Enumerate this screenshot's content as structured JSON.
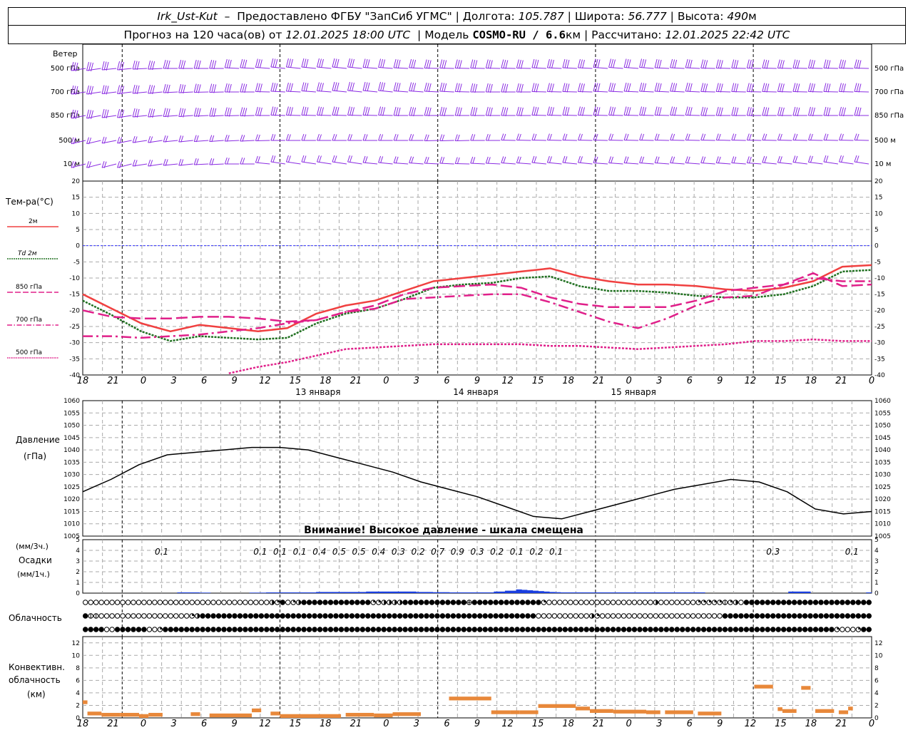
{
  "header": {
    "station": "Irk_Ust-Kut",
    "provider": "Предоставлено ФГБУ \"ЗапСиб УГМС\"",
    "lon_label": "Долгота:",
    "lon_value": "105.787",
    "lat_label": "Широта:",
    "lat_value": "56.777",
    "alt_label": "Высота:",
    "alt_value": "490",
    "alt_unit": "м",
    "forecast_label": "Прогноз на 120 часа(ов) от",
    "forecast_time": "12.01.2025 18:00 UTC",
    "model_label": "Модель",
    "model_name": "COSMO-RU / 6.6",
    "model_unit": "км",
    "calc_label": "Рассчитано:",
    "calc_time": "12.01.2025 22:42 UTC"
  },
  "labels": {
    "wind": "Ветер",
    "wind_levels": [
      "500 гПа",
      "700 гПа",
      "850 гПа",
      "500 м",
      "10 м"
    ],
    "temp": "Тем-ра(°C)",
    "pressure": "Давление",
    "pressure_unit": "(гПа)",
    "precip_unit_3h": "(мм/3ч.)",
    "precip": "Осадки",
    "precip_unit_1h": "(мм/1ч.)",
    "cloud": "Облачность",
    "conv_1": "Конвективн.",
    "conv_2": "облачность",
    "conv_3": "(км)",
    "warning": "Внимание! Высокое давление - шкала смещена",
    "days": [
      "13 января",
      "14 января",
      "15 января"
    ]
  },
  "chart_data": {
    "type": "line",
    "time_ticks": [
      "18",
      "21",
      "0",
      "3",
      "6",
      "9",
      "12",
      "15",
      "18",
      "21",
      "0",
      "3",
      "6",
      "9",
      "12",
      "15",
      "18",
      "21",
      "0",
      "3",
      "6",
      "9",
      "12",
      "15",
      "18",
      "21",
      "0"
    ],
    "temperature": {
      "ylim": [
        -40,
        20
      ],
      "ticks": [
        20,
        15,
        10,
        5,
        0,
        -5,
        -10,
        -15,
        -20,
        -25,
        -30,
        -35,
        -40
      ],
      "series": [
        {
          "name": "2м",
          "color": "#f04040",
          "values": [
            -15,
            -19.5,
            -24,
            -26.5,
            -24.5,
            -25.5,
            -26.5,
            -25.5,
            -21,
            -18.5,
            -17,
            -14,
            -11,
            -10,
            -9,
            -8,
            -7,
            -9.5,
            -11,
            -12,
            -12,
            -12.5,
            -13.5,
            -14,
            -13,
            -11,
            -6.5,
            -6
          ]
        },
        {
          "name": "Td 2м",
          "color": "#207020",
          "values": [
            -17,
            -21.5,
            -26.5,
            -29.5,
            -28,
            -28.5,
            -29,
            -28.5,
            -24,
            -21,
            -19.5,
            -16.5,
            -13,
            -12,
            -11.5,
            -10,
            -9.5,
            -12.5,
            -14,
            -14,
            -14.5,
            -15.5,
            -16,
            -16,
            -15,
            -12.5,
            -8,
            -7.5
          ]
        },
        {
          "name": "850 гПа",
          "color": "#e0208a",
          "values": [
            -20,
            -22,
            -22.5,
            -22.5,
            -22,
            -22,
            -22.5,
            -23.5,
            -23,
            -20.5,
            -18.5,
            -15,
            -13,
            -12.5,
            -12,
            -13,
            -16,
            -18,
            -19,
            -19,
            -19,
            -17,
            -14,
            -13,
            -12,
            -8.5,
            -12.5,
            -12
          ]
        },
        {
          "name": "700 гПа",
          "color": "#e0208a",
          "values": [
            -28,
            -28,
            -28.5,
            -28,
            -27.5,
            -26.5,
            -25.5,
            -24,
            -23,
            -20.5,
            -19.5,
            -16.5,
            -16,
            -15.5,
            -15,
            -15,
            -17.5,
            -20.5,
            -23.5,
            -25.5,
            -22.5,
            -18.5,
            -16,
            -15.5,
            -12,
            -10,
            -11,
            -11
          ]
        },
        {
          "name": "500 гПа",
          "color": "#e0208a",
          "values": [
            null,
            null,
            null,
            null,
            null,
            -39.5,
            -37.5,
            -36,
            -34,
            -32,
            -31.5,
            -31,
            -30.5,
            -30.5,
            -30.5,
            -30.5,
            -31,
            -31,
            -31.5,
            -32,
            -31.5,
            -31,
            -30.5,
            -29.5,
            -29.5,
            -29,
            -29.5,
            -29.5
          ]
        }
      ]
    },
    "pressure": {
      "ylim": [
        1005,
        1060
      ],
      "ticks": [
        1060,
        1055,
        1050,
        1045,
        1040,
        1035,
        1030,
        1025,
        1020,
        1015,
        1010,
        1005
      ],
      "values": [
        1023,
        1028,
        1034,
        1038,
        1039,
        1040,
        1041,
        1041,
        1040,
        1037,
        1034,
        1031,
        1027,
        1024,
        1021,
        1017,
        1013,
        1012,
        1015,
        1018,
        1021,
        1024,
        1026,
        1028,
        1027,
        1023,
        1016,
        1014,
        1015
      ]
    },
    "precipitation": {
      "ylim": [
        0,
        5
      ],
      "ticks": [
        5,
        4,
        3,
        2,
        1,
        0
      ],
      "sums_3h": [
        "0.1",
        "0.1",
        "0.1",
        "0.1",
        "0.4",
        "0.5",
        "0.5",
        "0.4",
        "0.3",
        "0.2",
        "0.7",
        "0.9",
        "0.3",
        "0.2",
        "0.1",
        "0.2",
        "0.1",
        "0.3",
        "0.1"
      ],
      "hourly_mm": [
        0,
        0,
        0,
        0,
        0,
        0,
        0,
        0,
        0,
        0,
        0,
        0,
        0,
        0,
        0,
        0,
        0,
        0.1,
        0.1,
        0.1,
        0.1,
        0.05,
        0.05,
        0,
        0,
        0,
        0,
        0,
        0,
        0,
        0.05,
        0.05,
        0.05,
        0.1,
        0.1,
        0.1,
        0.1,
        0.1,
        0.1,
        0.1,
        0.1,
        0.1,
        0.2,
        0.2,
        0.2,
        0.2,
        0.2,
        0.2,
        0.2,
        0.2,
        0.2,
        0.3,
        0.3,
        0.3,
        0.3,
        0.3,
        0.3,
        0.3,
        0.3,
        0.3,
        0.2,
        0.2,
        0.2,
        0.15,
        0.15,
        0.15,
        0.1,
        0.1,
        0.1,
        0.1,
        0.1,
        0.1,
        0.1,
        0.1,
        0.3,
        0.3,
        0.5,
        0.5,
        0.8,
        0.7,
        0.6,
        0.5,
        0.4,
        0.3,
        0.2,
        0.15,
        0.1,
        0.1,
        0.1,
        0.1,
        0.1,
        0.1,
        0.1,
        0.1,
        0.1,
        0.1,
        0.1,
        0.1,
        0.1,
        0.1,
        0.1,
        0.1,
        0.1,
        0.1,
        0.1,
        0.1,
        0.1,
        0.1,
        0.1,
        0.1,
        0.1,
        0.1,
        0,
        0,
        0,
        0,
        0,
        0,
        0,
        0,
        0,
        0,
        0,
        0,
        0,
        0,
        0,
        0.3,
        0.3,
        0.3,
        0.3,
        0,
        0,
        0,
        0,
        0,
        0,
        0,
        0,
        0,
        0,
        0.1
      ]
    },
    "cloud_cover_rows": [
      "0000000000000000000000000000000000032402344444444444442233334444444444448444444444444420000000000000000000030000000222221230444444444444444444444444",
      "4110000000000000000023444444444444444444444444444444444444444444444444444444444444444000000000032000000000000000000000004444444444444444444444444444",
      "4444004444440024444444444444444444444444444444444444444444444444444444444444444444444444444444444444444444444444444444444444444444444444444442000244"
    ],
    "convective_cloud": {
      "ylim": [
        0,
        13
      ],
      "ticks": [
        12,
        10,
        8,
        6,
        4,
        2,
        0
      ],
      "segments": [
        [
          18,
          19,
          2.8
        ],
        [
          19,
          22,
          1.0
        ],
        [
          22,
          26,
          0.8
        ],
        [
          26,
          30,
          0.8
        ],
        [
          30,
          32,
          0.6
        ],
        [
          32,
          35,
          0.8
        ],
        [
          41,
          43,
          0.9
        ],
        [
          45,
          54,
          0.7
        ],
        [
          54,
          56,
          1.5
        ],
        [
          58,
          60,
          1.0
        ],
        [
          60,
          73,
          0.6
        ],
        [
          74,
          80,
          0.8
        ],
        [
          80,
          84,
          0.7
        ],
        [
          84,
          90,
          0.9
        ],
        [
          96,
          105,
          3.4
        ],
        [
          105,
          109,
          1.2
        ],
        [
          109,
          111,
          1.2
        ],
        [
          111,
          115,
          1.2
        ],
        [
          115,
          120,
          2.2
        ],
        [
          120,
          123,
          2.2
        ],
        [
          123,
          126,
          1.8
        ],
        [
          126,
          131,
          1.4
        ],
        [
          131,
          138,
          1.3
        ],
        [
          138,
          141,
          1.2
        ],
        [
          142,
          148,
          1.2
        ],
        [
          149,
          154,
          1.0
        ],
        [
          161,
          165,
          5.3
        ],
        [
          166,
          167,
          1.7
        ],
        [
          167,
          170,
          1.4
        ],
        [
          171,
          173,
          5.1
        ],
        [
          174,
          178,
          1.4
        ],
        [
          179,
          181,
          1.2
        ],
        [
          181,
          182,
          1.8
        ]
      ]
    }
  }
}
